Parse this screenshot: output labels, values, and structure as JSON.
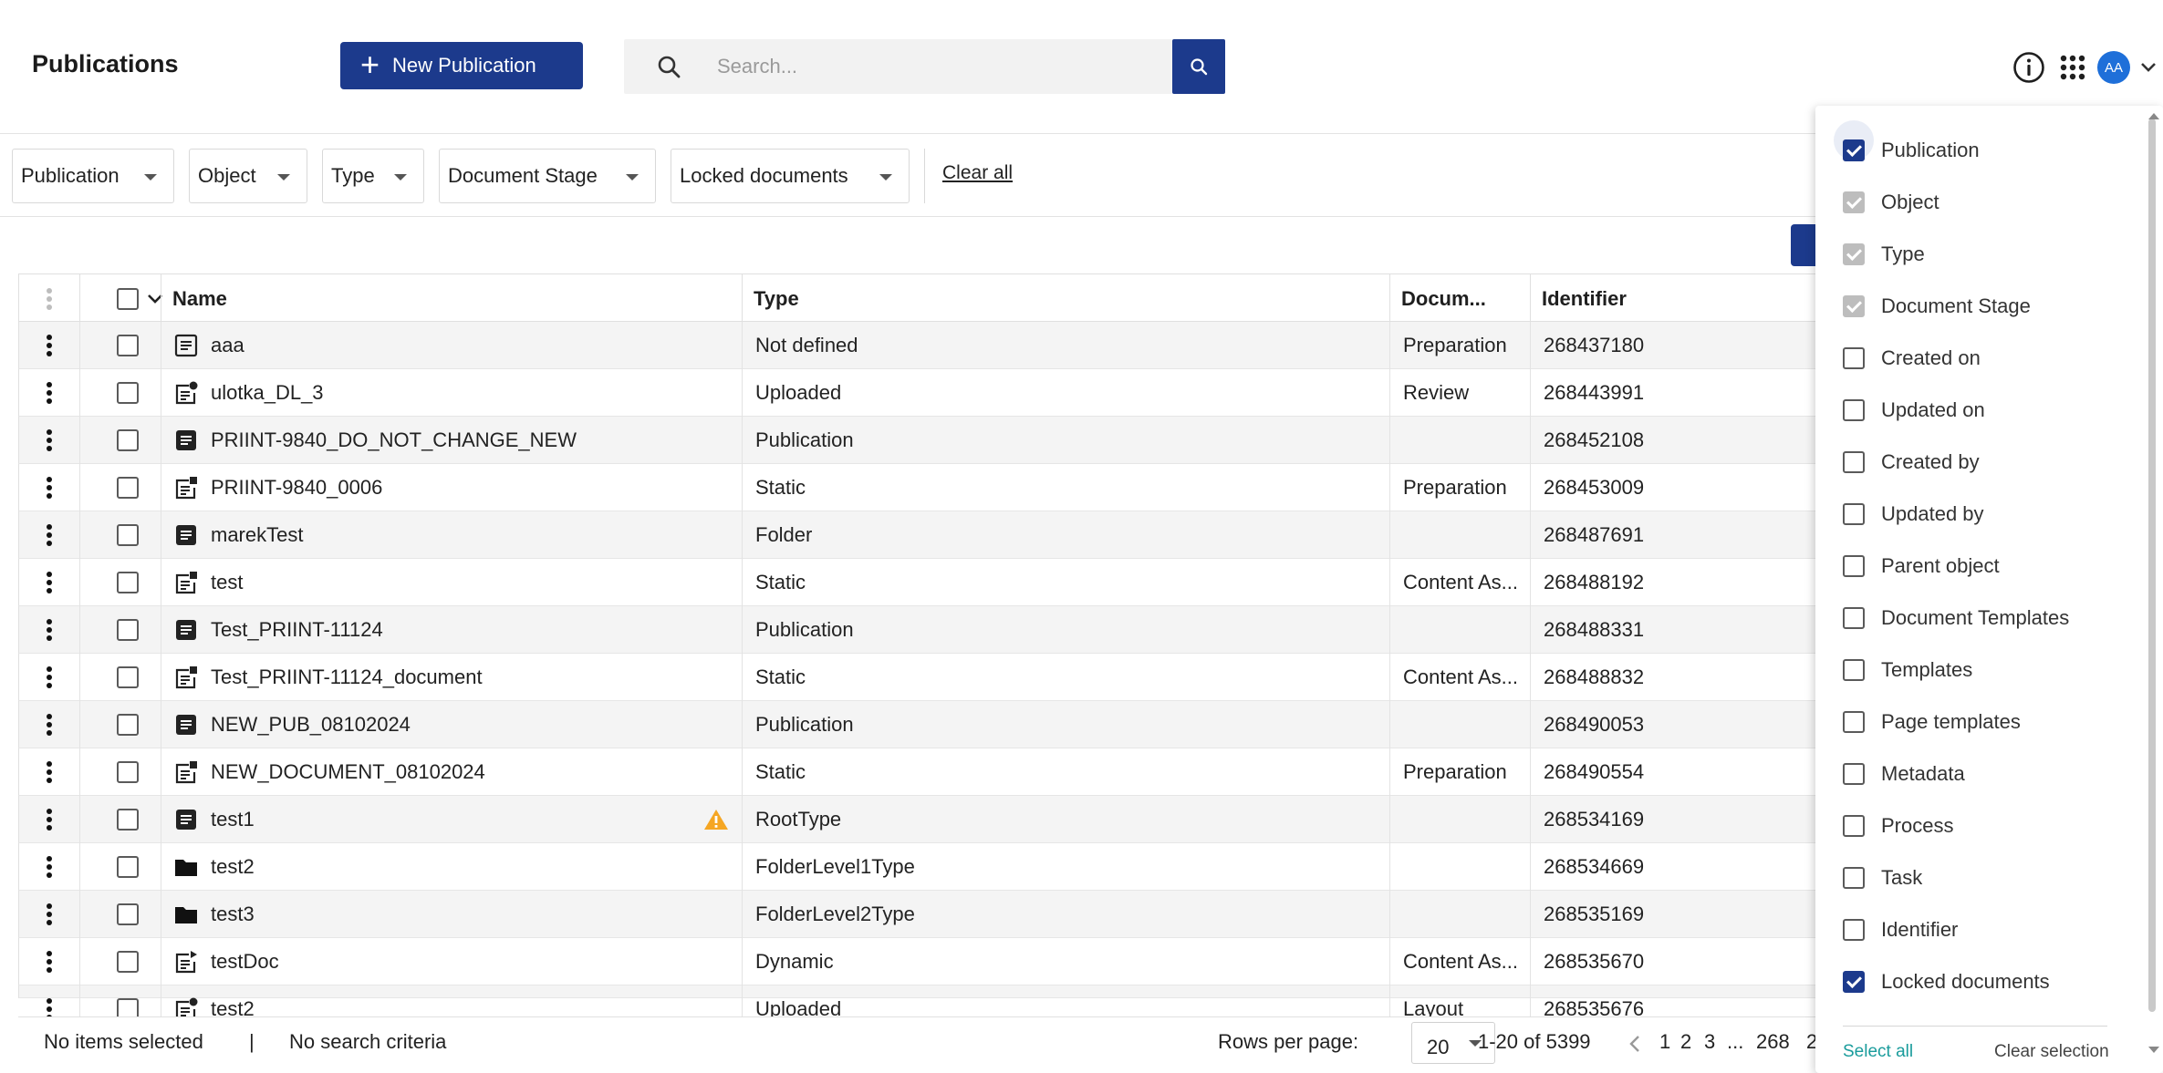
{
  "header": {
    "title": "Publications",
    "new_button_label": "New Publication",
    "search_placeholder": "Search...",
    "avatar_initials": "AA"
  },
  "filters": {
    "items": [
      "Publication",
      "Object",
      "Type",
      "Document Stage",
      "Locked documents"
    ],
    "clear_all": "Clear all"
  },
  "table": {
    "columns": [
      "Name",
      "Type",
      "Docum...",
      "Identifier"
    ],
    "rows": [
      {
        "name": "aaa",
        "icon": "document-icon",
        "type": "Not defined",
        "stage": "Preparation",
        "id": "268437180"
      },
      {
        "name": "ulotka_DL_3",
        "icon": "document-uploaded-icon",
        "type": "Uploaded",
        "stage": "Review",
        "id": "268443991"
      },
      {
        "name": "PRIINT-9840_DO_NOT_CHANGE_NEW",
        "icon": "publication-icon",
        "type": "Publication",
        "stage": "",
        "id": "268452108"
      },
      {
        "name": "PRIINT-9840_0006",
        "icon": "document-static-icon",
        "type": "Static",
        "stage": "Preparation",
        "id": "268453009"
      },
      {
        "name": "marekTest",
        "icon": "publication-icon",
        "type": "Folder",
        "stage": "",
        "id": "268487691"
      },
      {
        "name": "test",
        "icon": "document-static-icon",
        "type": "Static",
        "stage": "Content As...",
        "id": "268488192"
      },
      {
        "name": "Test_PRIINT-11124",
        "icon": "publication-icon",
        "type": "Publication",
        "stage": "",
        "id": "268488331"
      },
      {
        "name": "Test_PRIINT-11124_document",
        "icon": "document-static-icon",
        "type": "Static",
        "stage": "Content As...",
        "id": "268488832"
      },
      {
        "name": "NEW_PUB_08102024",
        "icon": "publication-icon",
        "type": "Publication",
        "stage": "",
        "id": "268490053"
      },
      {
        "name": "NEW_DOCUMENT_08102024",
        "icon": "document-static-icon",
        "type": "Static",
        "stage": "Preparation",
        "id": "268490554"
      },
      {
        "name": "test1",
        "icon": "publication-icon",
        "type": "RootType",
        "stage": "",
        "id": "268534169",
        "warning": true
      },
      {
        "name": "test2",
        "icon": "folder-icon",
        "type": "FolderLevel1Type",
        "stage": "",
        "id": "268534669"
      },
      {
        "name": "test3",
        "icon": "folder-icon",
        "type": "FolderLevel2Type",
        "stage": "",
        "id": "268535169"
      },
      {
        "name": "testDoc",
        "icon": "document-dynamic-icon",
        "type": "Dynamic",
        "stage": "Content As...",
        "id": "268535670"
      },
      {
        "name": "test2",
        "icon": "document-uploaded-icon",
        "type": "Uploaded",
        "stage": "Layout",
        "id": "268535676"
      }
    ]
  },
  "footer": {
    "selection": "No items selected",
    "separator": "|",
    "criteria": "No search criteria",
    "rows_per_page_label": "Rows per page:",
    "rows_per_page_value": "20",
    "range": "1-20 of 5399",
    "pages": [
      "1",
      "2",
      "3",
      "...",
      "268",
      "2"
    ]
  },
  "column_panel": {
    "options": [
      {
        "label": "Publication",
        "state": "checked"
      },
      {
        "label": "Object",
        "state": "disabled"
      },
      {
        "label": "Type",
        "state": "disabled"
      },
      {
        "label": "Document Stage",
        "state": "disabled"
      },
      {
        "label": "Created on",
        "state": "unchecked"
      },
      {
        "label": "Updated on",
        "state": "unchecked"
      },
      {
        "label": "Created by",
        "state": "unchecked"
      },
      {
        "label": "Updated by",
        "state": "unchecked"
      },
      {
        "label": "Parent object",
        "state": "unchecked"
      },
      {
        "label": "Document Templates",
        "state": "unchecked"
      },
      {
        "label": "Templates",
        "state": "unchecked"
      },
      {
        "label": "Page templates",
        "state": "unchecked"
      },
      {
        "label": "Metadata",
        "state": "unchecked"
      },
      {
        "label": "Process",
        "state": "unchecked"
      },
      {
        "label": "Task",
        "state": "unchecked"
      },
      {
        "label": "Identifier",
        "state": "unchecked"
      },
      {
        "label": "Locked documents",
        "state": "checked"
      }
    ],
    "select_all": "Select all",
    "clear_selection": "Clear selection"
  },
  "colors": {
    "primary": "#1c3a8c",
    "link_teal": "#1a9c9c",
    "warning": "#f5a623",
    "avatar": "#1e6fd9"
  }
}
